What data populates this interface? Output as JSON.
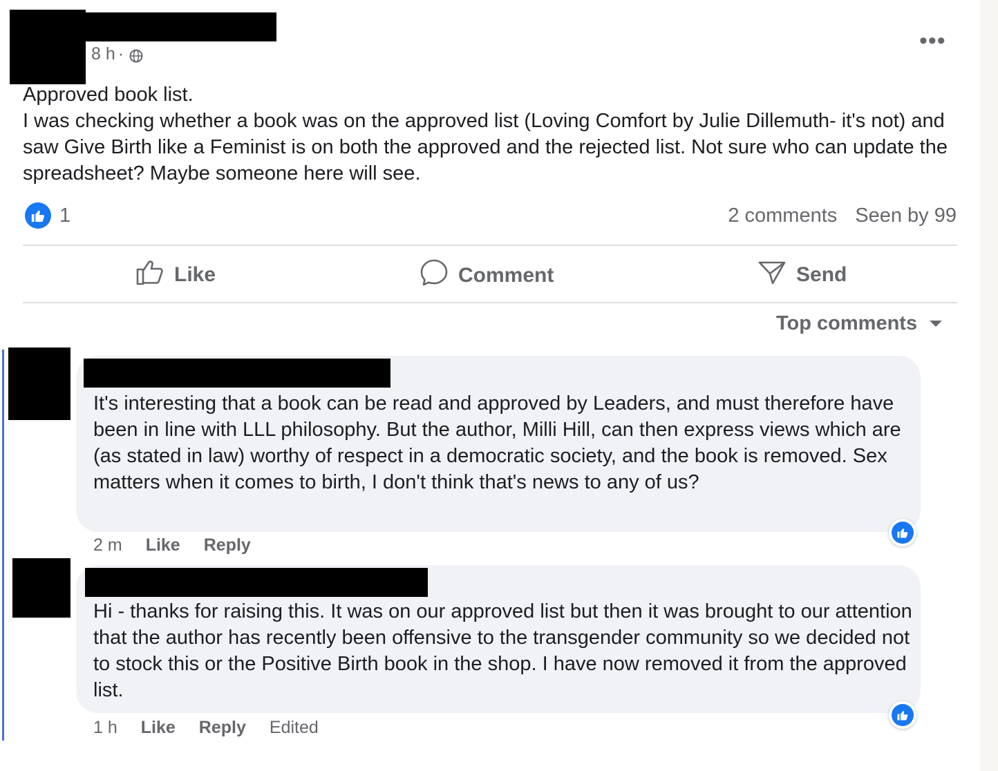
{
  "post": {
    "timestamp": "8 h",
    "separator": "·",
    "audience_icon": "globe-icon",
    "more_icon": "more-options-icon",
    "more_glyph": "•••",
    "title": "Approved book list.",
    "body": "I was checking whether a book was on the approved list (Loving Comfort by Julie Dillemuth- it's not) and saw Give Birth like a Feminist is on both the approved and the rejected list. Not sure who can update the spreadsheet? Maybe someone here will see.",
    "reaction_count": "1",
    "comments_count": "2 comments",
    "seen_by": "Seen by 99"
  },
  "actions": {
    "like": "Like",
    "comment": "Comment",
    "send": "Send"
  },
  "comments_sort": "Top comments",
  "comments": [
    {
      "text": "It's interesting that a book can be read and approved by Leaders, and must therefore have been in line with LLL philosophy. But the author, Milli Hill, can then express views which are (as stated in law) worthy of respect in a democratic society, and the book is removed. Sex matters when it comes to birth, I don't think that's news to any of us?",
      "time": "2 m",
      "like": "Like",
      "reply": "Reply"
    },
    {
      "text": "Hi - thanks for raising this. It was on our approved list but then it was brought to our attention that the author has recently been offensive to the transgender community so we decided not to stock this or the Positive Birth book in the shop. I have now removed it from the approved list.",
      "time": "1 h",
      "like": "Like",
      "reply": "Reply",
      "edited": "Edited"
    }
  ],
  "colors": {
    "accent": "#1877f2",
    "secondary_text": "#65676b",
    "bubble": "#f0f2f5",
    "thread_line": "#4a6fd8"
  }
}
